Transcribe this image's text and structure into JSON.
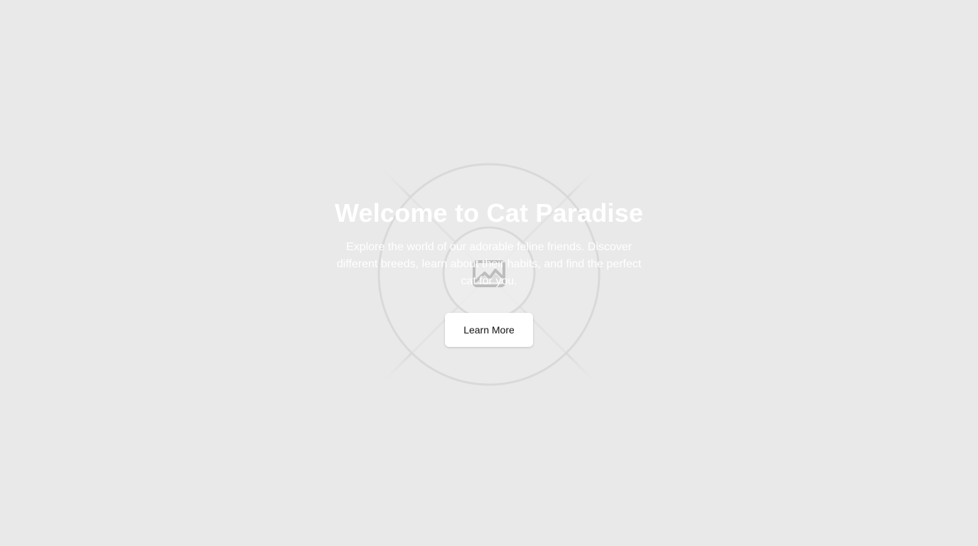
{
  "hero": {
    "title": "Welcome to Cat Paradise",
    "subtitle": "Explore the world of our adorable feline friends. Discover different breeds, learn about their habits, and find the perfect cat for you.",
    "button_label": "Learn More",
    "background_image_icon": "image-placeholder-icon"
  },
  "colors": {
    "background": "#e9e9e9",
    "text": "#ffffff",
    "button_background": "#ffffff",
    "button_text": "#111111",
    "placeholder_lines": "#d2d2d2"
  }
}
